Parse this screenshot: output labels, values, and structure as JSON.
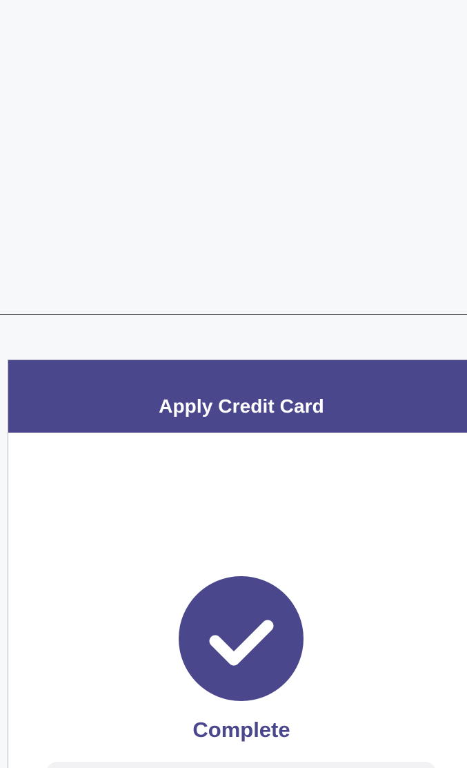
{
  "header": {
    "title": "Apply Credit Card"
  },
  "status": {
    "label": "Complete",
    "icon": "checkmark-icon"
  },
  "colors": {
    "brand": "#4a478d",
    "background": "#f7f8fa",
    "card": "#f2f2f5"
  }
}
